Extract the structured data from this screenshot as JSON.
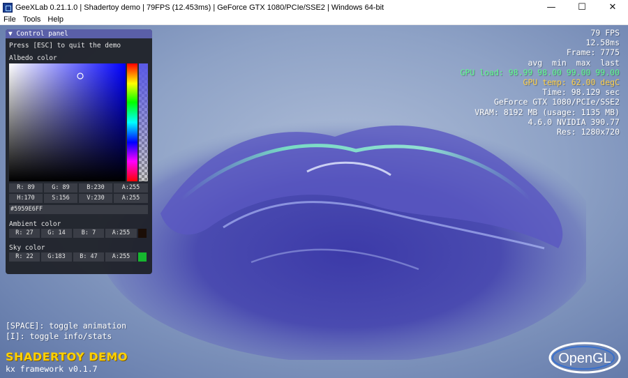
{
  "window": {
    "title": "GeeXLab 0.21.1.0 | Shadertoy demo | 79FPS (12.453ms) | GeForce GTX 1080/PCIe/SSE2 | Windows 64-bit",
    "minimize_glyph": "—",
    "maximize_glyph": "☐",
    "close_glyph": "✕"
  },
  "menu": [
    "File",
    "Tools",
    "Help"
  ],
  "stats": {
    "fps": "79 FPS",
    "ms": "12.58ms",
    "frame": "Frame: 7775",
    "header": "avg  min  max  last",
    "gpu_load": "GPU load: 98.99 98.00 99.00 99.00",
    "gpu_temp": "GPU temp: 62.00 degC",
    "time": "Time: 98.129 sec",
    "gpu_name": "GeForce GTX 1080/PCIe/SSE2",
    "vram": "VRAM: 8192 MB (usage: 1135 MB)",
    "driver": "4.6.0 NVIDIA 390.77",
    "res": "Res: 1280x720",
    "colors": {
      "gpu_load": "#5cff8a",
      "gpu_temp": "#ffd24a"
    }
  },
  "panel": {
    "title": "▼ Control panel",
    "quit_hint": "Press [ESC] to quit the demo",
    "albedo_label": "Albedo color",
    "albedo_rgb": [
      "R: 89",
      "G: 89",
      "B:230",
      "A:255"
    ],
    "albedo_hsv": [
      "H:170",
      "S:156",
      "V:230",
      "A:255"
    ],
    "albedo_hex": "#5959E6FF",
    "albedo_color": "#5959e6",
    "ambient_label": "Ambient color",
    "ambient_values": [
      "R: 27",
      "G: 14",
      "B:  7",
      "A:255"
    ],
    "ambient_color": "#1b0e07",
    "sky_label": "Sky color",
    "sky_values": [
      "R: 22",
      "G:183",
      "B: 47",
      "A:255"
    ],
    "sky_color": "#16b72f"
  },
  "hints": {
    "space": "[SPACE]: toggle animation",
    "info": "[I]: toggle info/stats"
  },
  "demo": {
    "title": "SHADERTOY DEMO",
    "framework": "kx framework v0.1.7"
  },
  "logo": {
    "text": "OpenGL"
  }
}
